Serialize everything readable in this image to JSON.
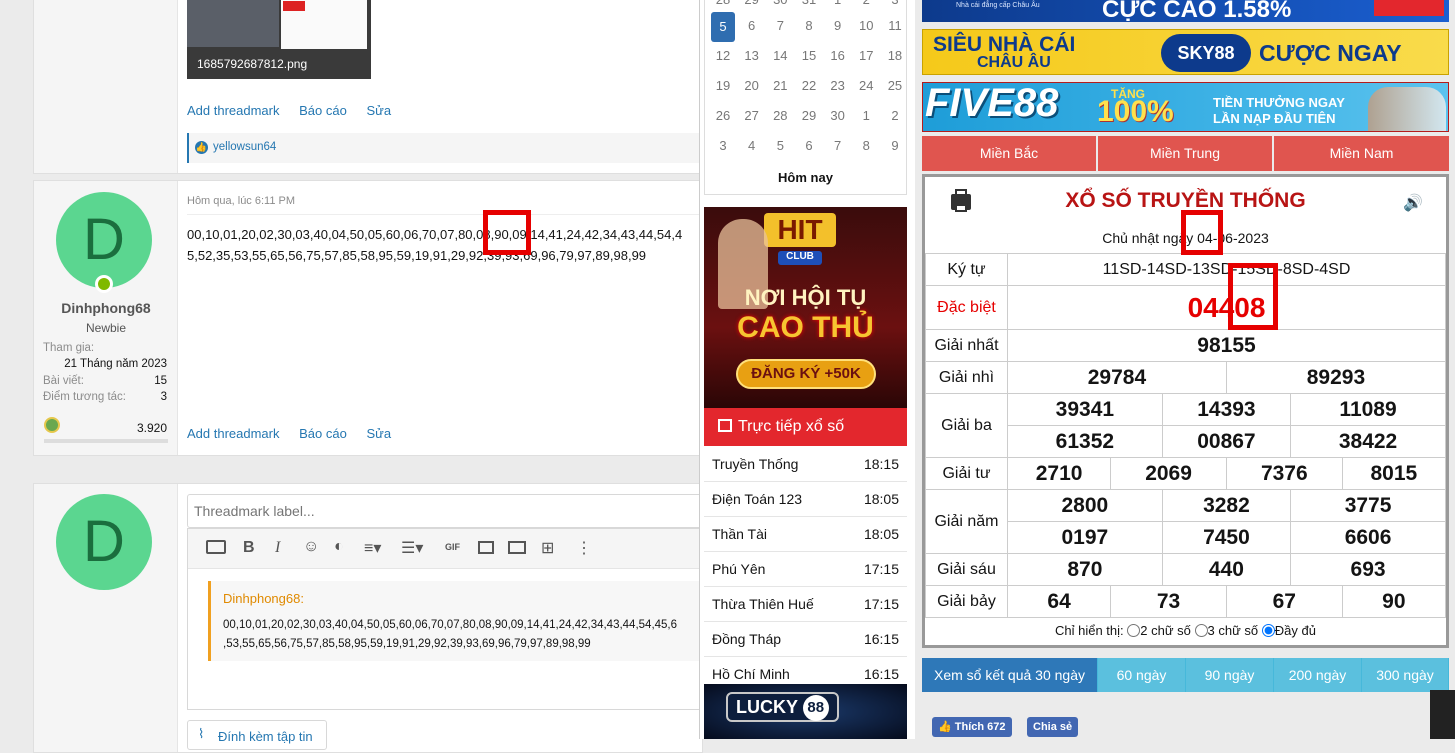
{
  "post1": {
    "attachment_name": "1685792687812.png",
    "actions": [
      "Add threadmark",
      "Báo cáo",
      "Sửa"
    ],
    "liker": "yellowsun64"
  },
  "post2": {
    "avatar_letter": "D",
    "username": "Dinhphong68",
    "title": "Newbie",
    "stats": [
      {
        "label": "Tham gia:",
        "value": "21 Tháng năm 2023"
      },
      {
        "label": "Bài viết:",
        "value": "15"
      },
      {
        "label": "Điểm tương tác:",
        "value": "3"
      }
    ],
    "points": "3.920",
    "time": "Hôm qua, lúc 6:11 PM",
    "line1": "00,10,01,20,02,30,03,40,04,50,05,60,06,70,07,80,08,90,09,14,41,24,42,34,43,44,54,4",
    "line2": "5,52,35,53,55,65,56,75,57,85,58,95,59,19,91,29,92,39,93,69,96,79,97,89,98,99",
    "actions": [
      "Add threadmark",
      "Báo cáo",
      "Sửa"
    ]
  },
  "reply": {
    "avatar_letter": "D",
    "threadmark_placeholder": "Threadmark label...",
    "quote_author": "Dinhphong68:",
    "quote_line1": "00,10,01,20,02,30,03,40,04,50,05,60,06,70,07,80,08,90,09,14,41,24,42,34,43,44,54,45,6",
    "quote_line2": ",53,55,65,56,75,57,85,58,95,59,19,91,29,92,39,93,69,96,79,97,89,98,99",
    "attach_label": "Đính kèm tập tin"
  },
  "calendar": {
    "rows": [
      [
        "28",
        "29",
        "30",
        "31",
        "1",
        "2",
        "3"
      ],
      [
        "5",
        "6",
        "7",
        "8",
        "9",
        "10",
        "11"
      ],
      [
        "12",
        "13",
        "14",
        "15",
        "16",
        "17",
        "18"
      ],
      [
        "19",
        "20",
        "21",
        "22",
        "23",
        "24",
        "25"
      ],
      [
        "26",
        "27",
        "28",
        "29",
        "30",
        "1",
        "2"
      ],
      [
        "3",
        "4",
        "5",
        "6",
        "7",
        "8",
        "9"
      ]
    ],
    "today_label": "Hôm nay"
  },
  "ad_hit": {
    "brand": "HIT",
    "club": "CLUB",
    "line1": "NƠI HỘI TỤ",
    "line2": "CAO THỦ",
    "cta": "ĐĂNG KÝ +50K"
  },
  "live": {
    "header": "Trực tiếp xổ số",
    "items": [
      {
        "name": "Truyền Thống",
        "time": "18:15"
      },
      {
        "name": "Điện Toán 123",
        "time": "18:05"
      },
      {
        "name": "Thần Tài",
        "time": "18:05"
      },
      {
        "name": "Phú Yên",
        "time": "17:15"
      },
      {
        "name": "Thừa Thiên Huế",
        "time": "17:15"
      },
      {
        "name": "Đồng Tháp",
        "time": "16:15"
      },
      {
        "name": "Hồ Chí Minh",
        "time": "16:15"
      }
    ]
  },
  "ad_lucky": {
    "brand": "LUCKY",
    "num": "88"
  },
  "banners": {
    "b1_text": "CỰC CAO 1.58%",
    "b1_small": "Nhà cái đẳng cấp Châu Âu",
    "b2_left1": "SIÊU NHÀ CÁI",
    "b2_left2": "CHÂU ÂU",
    "b2_brand": "SKY88",
    "b2_right": "CƯỢC NGAY",
    "b3_brand": "FIVE88",
    "b3_bonus_small": "TẶNG",
    "b3_bonus": "100%",
    "b3_line1": "TIỀN THƯỞNG NGAY",
    "b3_line2": "LẦN NẠP ĐẦU TIÊN"
  },
  "regions": [
    "Miền Bắc",
    "Miền Trung",
    "Miền Nam"
  ],
  "result": {
    "title": "XỔ SỐ TRUYỀN THỐNG",
    "date": "Chủ nhật ngày 04-06-2023",
    "ky_tu_label": "Ký tự",
    "ky_tu": "11SD-14SD-13SD-15SD-8SD-4SD",
    "db_label": "Đặc biệt",
    "db": "04408",
    "g1_label": "Giải nhất",
    "g1": "98155",
    "g2_label": "Giải nhì",
    "g2": [
      "29784",
      "89293"
    ],
    "g3_label": "Giải ba",
    "g3": [
      "39341",
      "14393",
      "11089",
      "61352",
      "00867",
      "38422"
    ],
    "g4_label": "Giải tư",
    "g4": [
      "2710",
      "2069",
      "7376",
      "8015"
    ],
    "g5_label": "Giải năm",
    "g5": [
      "2800",
      "3282",
      "3775",
      "0197",
      "7450",
      "6606"
    ],
    "g6_label": "Giải sáu",
    "g6": [
      "870",
      "440",
      "693"
    ],
    "g7_label": "Giải bảy",
    "g7": [
      "64",
      "73",
      "67",
      "90"
    ],
    "filter_label": "Chỉ hiển thị:",
    "filter_opts": [
      "2 chữ số",
      "3 chữ số",
      "Đầy đủ"
    ]
  },
  "range_buttons": [
    "Xem sổ kết quả 30 ngày",
    "60 ngày",
    "90 ngày",
    "200 ngày",
    "300 ngày"
  ],
  "social": {
    "like": "Thích 672",
    "share": "Chia sẻ"
  },
  "colors": {
    "accent_red": "#e3272d",
    "link": "#2577b1",
    "avatar": "#5bd690",
    "highlight": "#e60000"
  }
}
